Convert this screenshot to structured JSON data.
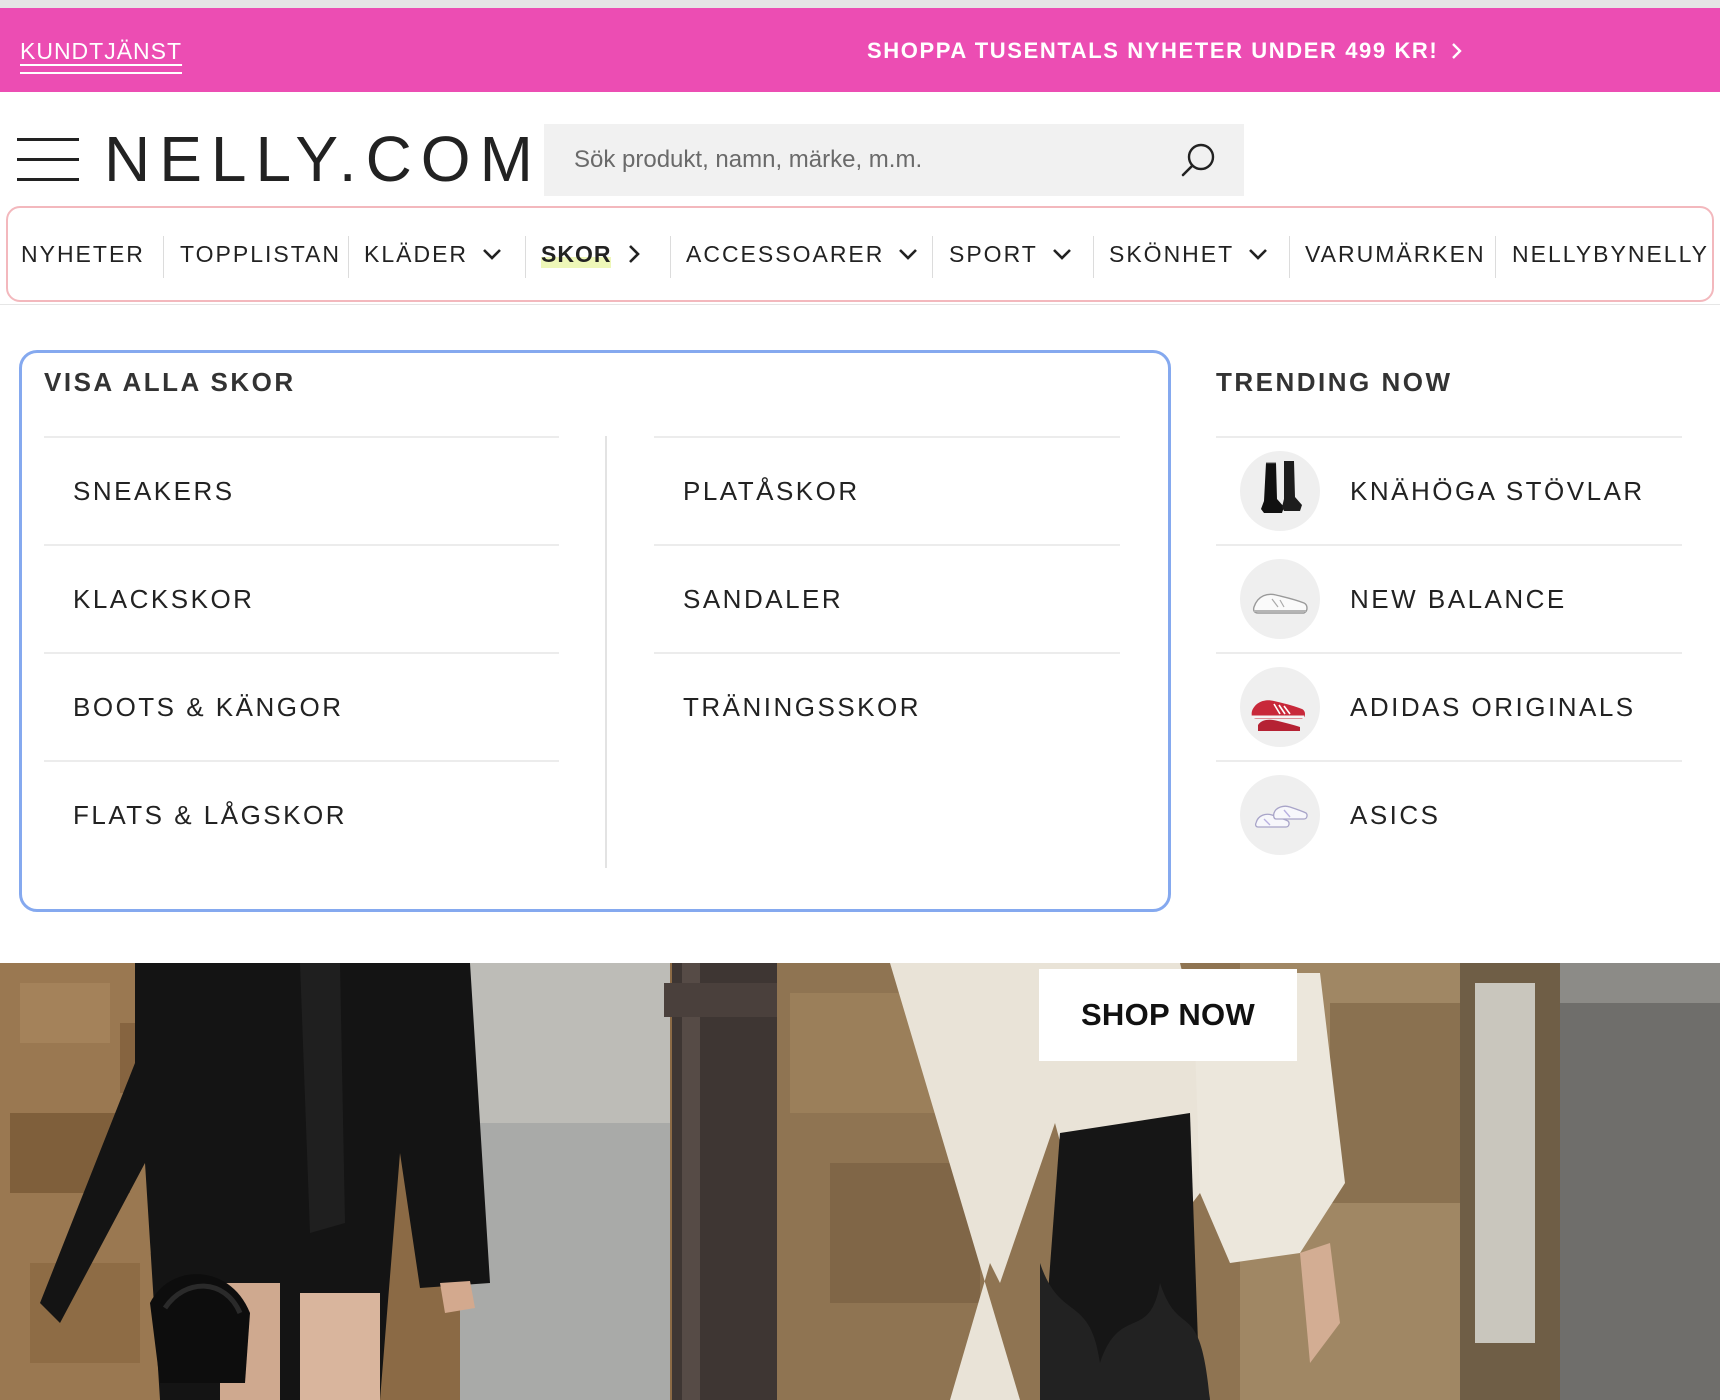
{
  "promo": {
    "customer_service": "KUNDTJÄNST",
    "message": "SHOPPA TUSENTALS NYHETER UNDER 499 KR!"
  },
  "header": {
    "logo": "NELLY.COM",
    "search_placeholder": "Sök produkt, namn, märke, m.m."
  },
  "nav": {
    "items": [
      {
        "label": "NYHETER"
      },
      {
        "label": "TOPPLISTAN"
      },
      {
        "label": "KLÄDER"
      },
      {
        "label": "SKOR"
      },
      {
        "label": "ACCESSOARER"
      },
      {
        "label": "SPORT"
      },
      {
        "label": "SKÖNHET"
      },
      {
        "label": "VARUMÄRKEN"
      },
      {
        "label": "NELLYBYNELLY"
      }
    ],
    "active": "SKOR"
  },
  "shoes_menu": {
    "heading": "VISA ALLA SKOR",
    "column_left": [
      "SNEAKERS",
      "KLACKSKOR",
      "BOOTS & KÄNGOR",
      "FLATS & LÅGSKOR"
    ],
    "column_right": [
      "PLATÅSKOR",
      "SANDALER",
      "TRÄNINGSSKOR"
    ]
  },
  "trending": {
    "heading": "TRENDING NOW",
    "items": [
      {
        "label": "KNÄHÖGA STÖVLAR",
        "icon": "knee-boots-icon"
      },
      {
        "label": "NEW BALANCE",
        "icon": "white-sneaker-icon"
      },
      {
        "label": "ADIDAS ORIGINALS",
        "icon": "red-sneaker-icon"
      },
      {
        "label": "ASICS",
        "icon": "white-sneakers-pair-icon"
      }
    ]
  },
  "hero": {
    "cta": "SHOP NOW"
  },
  "colors": {
    "promo_bar": "#ec4db3",
    "nav_focus_outline": "#f3b8bd",
    "menu_focus_outline": "#85a9ef",
    "active_highlight": "#eef7b8"
  }
}
